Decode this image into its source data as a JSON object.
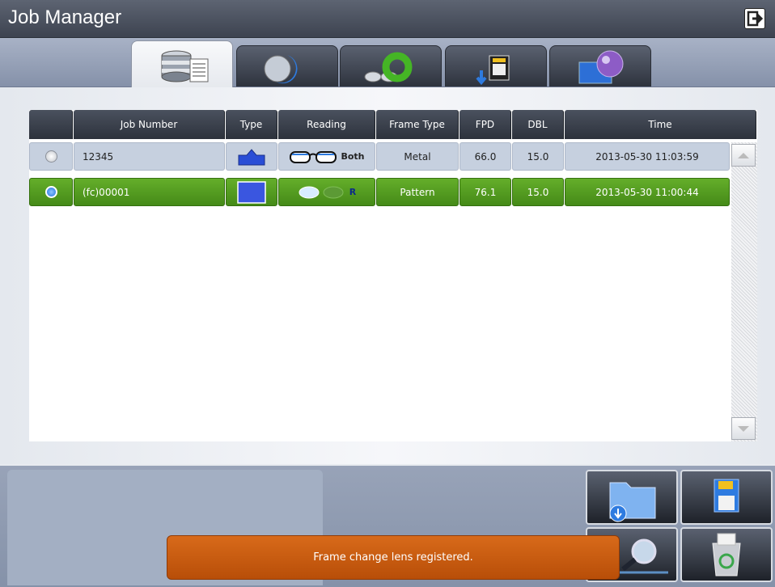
{
  "app": {
    "title": "Job Manager"
  },
  "tabs": [
    {
      "name": "job-list",
      "icon": "database-icon",
      "active": true
    },
    {
      "name": "lens",
      "icon": "lens-icon",
      "active": false
    },
    {
      "name": "frame",
      "icon": "glasses-icon",
      "active": false
    },
    {
      "name": "sd-import",
      "icon": "sd-import-icon",
      "active": false
    },
    {
      "name": "display",
      "icon": "display-sphere-icon",
      "active": false
    }
  ],
  "table": {
    "headers": [
      "",
      "Job Number",
      "Type",
      "Reading",
      "Frame Type",
      "FPD",
      "DBL",
      "Time"
    ],
    "rows": [
      {
        "selected": false,
        "job_number": "12345",
        "type_icon": "frame-shape-icon",
        "reading": "Both",
        "frame_type": "Metal",
        "fpd": "66.0",
        "dbl": "15.0",
        "time": "2013-05-30  11:03:59"
      },
      {
        "selected": true,
        "job_number": "(fc)00001",
        "type_icon": "pattern-shape-icon",
        "reading": "R",
        "frame_type": "Pattern",
        "fpd": "76.1",
        "dbl": "15.0",
        "time": "2013-05-30  11:00:44"
      }
    ]
  },
  "toast": {
    "message": "Frame change lens registered."
  },
  "colors": {
    "selected_row": "#4f9b21",
    "toast": "#c95b10",
    "header": "#3a404b"
  },
  "actions": [
    "folder-download-icon",
    "save-floppy-icon",
    "search-icon",
    "recycle-bin-icon"
  ]
}
